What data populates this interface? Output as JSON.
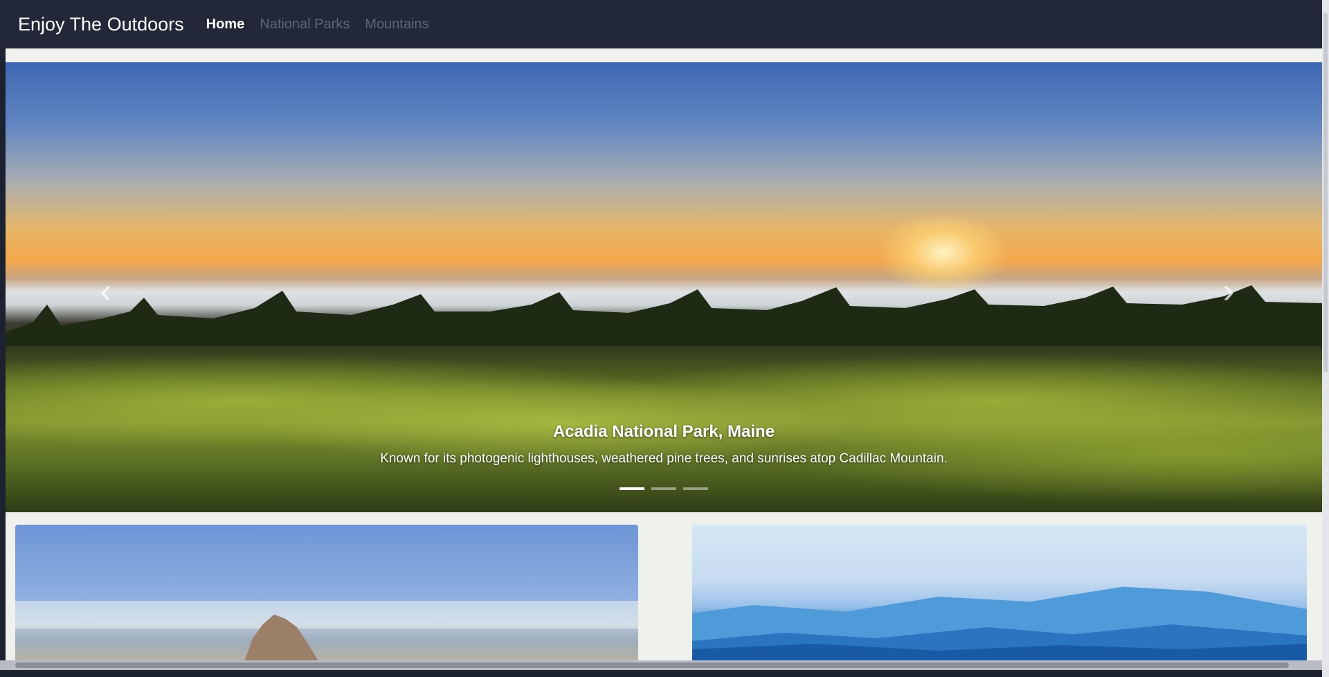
{
  "navbar": {
    "brand": "Enjoy The Outdoors",
    "links": [
      {
        "label": "Home",
        "active": true
      },
      {
        "label": "National Parks",
        "active": false
      },
      {
        "label": "Mountains",
        "active": false
      }
    ]
  },
  "carousel": {
    "caption_title": "Acadia National Park, Maine",
    "caption_text": "Known for its photogenic lighthouses, weathered pine trees, and sunrises atop Cadillac Mountain.",
    "prev_icon": "chevron-left-icon",
    "next_icon": "chevron-right-icon",
    "indicators": 3,
    "active_indicator": 0
  },
  "cards": [
    {
      "image": "rock-formation-landscape"
    },
    {
      "image": "blue-mountain-ridges"
    }
  ],
  "colors": {
    "navbar_bg": "#222838",
    "nav_active": "#ffffff",
    "nav_inactive": "#5d6678"
  }
}
